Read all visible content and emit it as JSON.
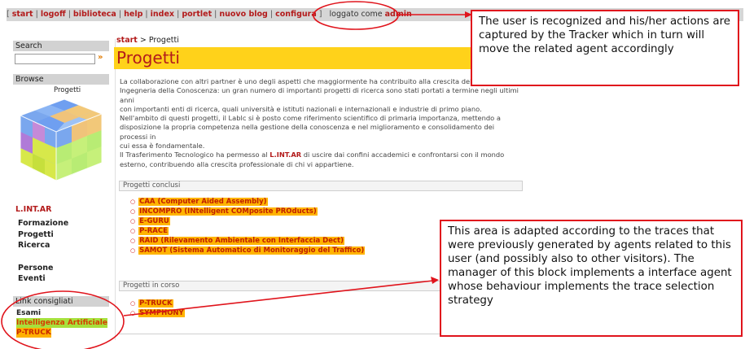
{
  "topbar": {
    "links": [
      "start",
      "logoff",
      "biblioteca",
      "help",
      "index",
      "portlet",
      "nuovo blog",
      "configura"
    ],
    "logged_as": "loggato come",
    "username": "admin"
  },
  "sidebar": {
    "search_title": "Search",
    "search_go": "»",
    "browse_title": "Browse",
    "cube_label": "Progetti",
    "org_name": "L.INT.AR",
    "nav_primary": [
      "Formazione",
      "Progetti",
      "Ricerca"
    ],
    "nav_secondary": [
      "Persone",
      "Eventi"
    ],
    "links_title": "Link consigliati",
    "links": [
      "Esami",
      "Intelligenza Artificiale",
      "P-TRUCK"
    ]
  },
  "main": {
    "breadcrumb_start": "start",
    "breadcrumb_rest": " > Progetti",
    "title": "Progetti",
    "paragraph_lines": [
      "La collaborazione con altri partner è uno degli aspetti che maggiormente ha contribuito alla crescita del Labo",
      "Ingegneria della Conoscenza: un gran numero di importanti progetti di ricerca sono stati portati a termine negli ultimi anni",
      "con importanti enti di ricerca, quali università e istituti nazionali e internazionali e industrie di primo piano.",
      "Nell'ambito di questi progetti, il Lablc si è posto come riferimento scientifico di primaria importanza, mettendo a",
      "disposizione la propria competenza nella gestione della conoscenza e nel miglioramento e consolidamento dei processi in",
      "cui essa è fondamentale.",
      "Il Trasferimento Tecnologico ha permesso al",
      "di uscire dai confini accademici e confrontarsi con il mondo",
      "esterno, contribuendo alla crescita professionale di chi vi appartiene."
    ],
    "org_inline": "L.INT.AR",
    "completed_title": "Progetti conclusi",
    "completed": [
      "CAA (Computer Aided Assembly)",
      "INCOMPRO (INtelligent COMposite PROducts)",
      "E-GURU",
      "P-RACE",
      "RAID (Rilevamento Ambientale con Interfaccia Dect)",
      "SAMOT (Sistema Automatico di Monitoraggio del Traffico)"
    ],
    "ongoing_title": "Progetti in corso",
    "ongoing": [
      "P-TRUCK",
      "SYMPHONY"
    ]
  },
  "annotations": {
    "tracker_note": "The user is recognized and his/her actions are captured by the Tracker which in turn will move the related agent accordingly",
    "adapt_note": "This area is adapted according to the traces that were previously generated by agents related to this user (and possibly also to other visitors). The manager of this block implements a interface agent whose behaviour implements the trace selection strategy"
  },
  "colors": {
    "accent_red": "#b31b1b",
    "title_yellow": "#ffd21a",
    "highlight_orange": "#ffb400",
    "highlight_green": "#a7e03c",
    "annotation_red": "#e0141c"
  }
}
